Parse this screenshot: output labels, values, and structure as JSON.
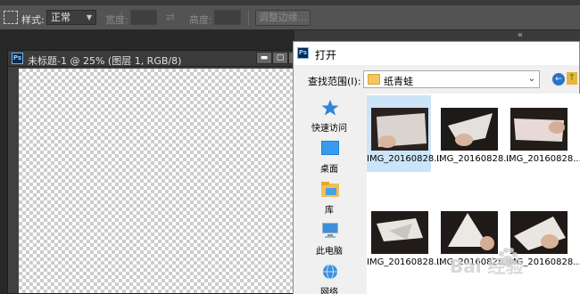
{
  "options_bar": {
    "style_label": "样式:",
    "style_value": "正常",
    "width_label": "宽度:",
    "height_label": "高度:",
    "refine_edge_label": "调整边缘..."
  },
  "document": {
    "title": "未标题-1 @ 25% (图层 1, RGB/8)",
    "ps_badge": "Ps",
    "minimize_symbol": "▬",
    "restore_symbol": "▢",
    "close_symbol": "✕"
  },
  "panel": {
    "collapse_symbol": "«"
  },
  "open_dialog": {
    "ps_badge": "Ps",
    "title": "打开",
    "look_in_label": "查找范围(I):",
    "look_in_value": "纸青蛙",
    "places": [
      {
        "label": "快速访问",
        "icon": "star-icon"
      },
      {
        "label": "桌面",
        "icon": "desktop-icon"
      },
      {
        "label": "库",
        "icon": "library-icon"
      },
      {
        "label": "此电脑",
        "icon": "computer-icon"
      },
      {
        "label": "网络",
        "icon": "network-icon"
      }
    ],
    "files": [
      {
        "name": "IMG_20160828..."
      },
      {
        "name": "IMG_20160828..."
      },
      {
        "name": "IMG_20160828..."
      },
      {
        "name": "IMG_20160828..."
      },
      {
        "name": "IMG_20160828..."
      },
      {
        "name": "IMG_20160828..."
      }
    ]
  },
  "watermark": {
    "text": "Bai  经验"
  },
  "colors": {
    "ps_dark": "#282828",
    "ps_bar": "#535353",
    "dialog_bg": "#f0f0f0",
    "selection": "#cce4f7",
    "ps_blue": "#6fb4ef"
  }
}
